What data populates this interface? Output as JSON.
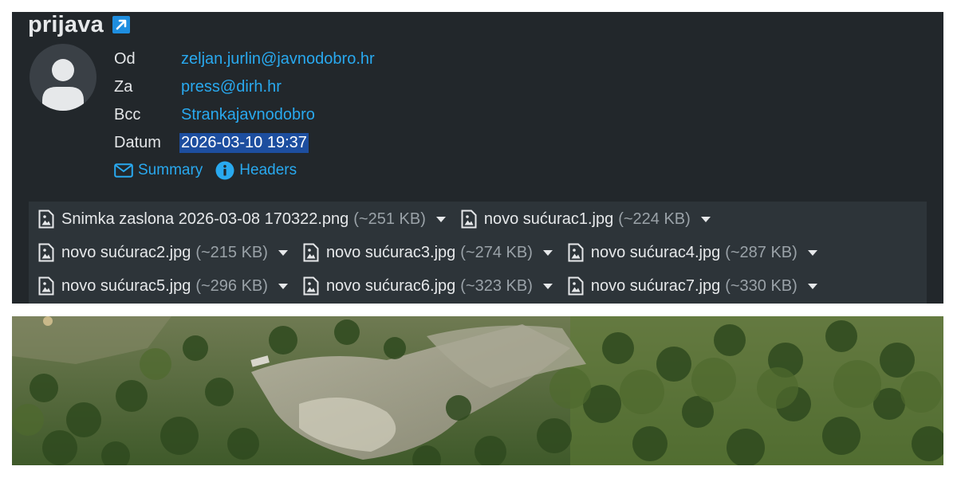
{
  "email": {
    "subject": "prijava",
    "fields": [
      {
        "label": "Od",
        "value": "zeljan.jurlin@javnodobro.hr",
        "selected": false
      },
      {
        "label": "Za",
        "value": "press@dirh.hr",
        "selected": false
      },
      {
        "label": "Bcc",
        "value": "Strankajavnodobro",
        "selected": false
      },
      {
        "label": "Datum",
        "value": "2026-03-10 19:37",
        "selected": true
      }
    ],
    "links": {
      "summary": "Summary",
      "headers": "Headers"
    },
    "attachments": [
      [
        {
          "name": "Snimka zaslona 2026-03-08 170322.png",
          "size": "(~251 KB)"
        },
        {
          "name": "novo sućurac1.jpg",
          "size": "(~224 KB)"
        }
      ],
      [
        {
          "name": "novo sućurac2.jpg",
          "size": "(~215 KB)"
        },
        {
          "name": "novo sućurac3.jpg",
          "size": "(~274 KB)"
        },
        {
          "name": "novo sućurac4.jpg",
          "size": "(~287 KB)"
        }
      ],
      [
        {
          "name": "novo sućurac5.jpg",
          "size": "(~296 KB)"
        },
        {
          "name": "novo sućurac6.jpg",
          "size": "(~323 KB)"
        },
        {
          "name": "novo sućurac7.jpg",
          "size": "(~330 KB)"
        }
      ]
    ]
  },
  "colors": {
    "panel_bg": "#22272b",
    "attachment_bg": "#2d3439",
    "link": "#29a9ef",
    "selection": "#1d4e9f"
  },
  "icons": {
    "subject_link": "external-link-icon",
    "summary": "envelope-icon",
    "headers": "info-icon",
    "attachment": "image-file-icon",
    "dropdown": "chevron-down-icon",
    "avatar": "person-icon"
  }
}
